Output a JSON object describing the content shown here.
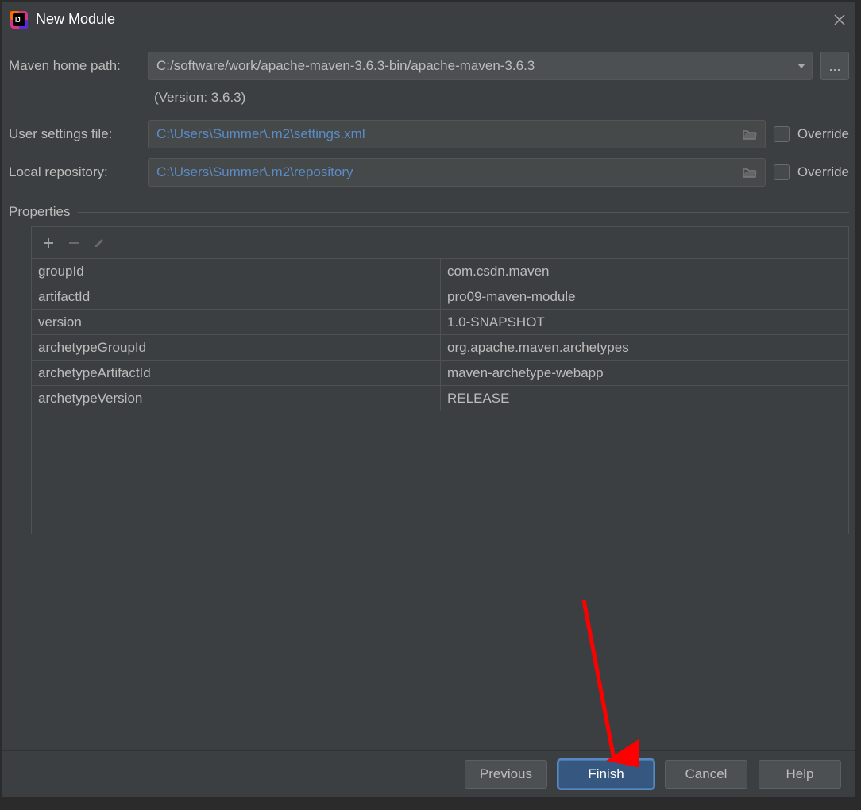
{
  "window": {
    "title": "New Module"
  },
  "form": {
    "maven_home_label": "Maven home path:",
    "maven_home_value": "C:/software/work/apache-maven-3.6.3-bin/apache-maven-3.6.3",
    "version_note": "(Version: 3.6.3)",
    "user_settings_label": "User settings file:",
    "user_settings_value": "C:\\Users\\Summer\\.m2\\settings.xml",
    "local_repo_label": "Local repository:",
    "local_repo_value": "C:\\Users\\Summer\\.m2\\repository",
    "override_label": "Override"
  },
  "properties": {
    "title": "Properties",
    "rows": [
      {
        "key": "groupId",
        "value": "com.csdn.maven"
      },
      {
        "key": "artifactId",
        "value": "pro09-maven-module"
      },
      {
        "key": "version",
        "value": "1.0-SNAPSHOT"
      },
      {
        "key": "archetypeGroupId",
        "value": "org.apache.maven.archetypes"
      },
      {
        "key": "archetypeArtifactId",
        "value": "maven-archetype-webapp"
      },
      {
        "key": "archetypeVersion",
        "value": "RELEASE"
      }
    ]
  },
  "buttons": {
    "previous": "Previous",
    "finish": "Finish",
    "cancel": "Cancel",
    "help": "Help"
  },
  "icons": {
    "browse_ellipsis": "...",
    "close": "✕"
  }
}
